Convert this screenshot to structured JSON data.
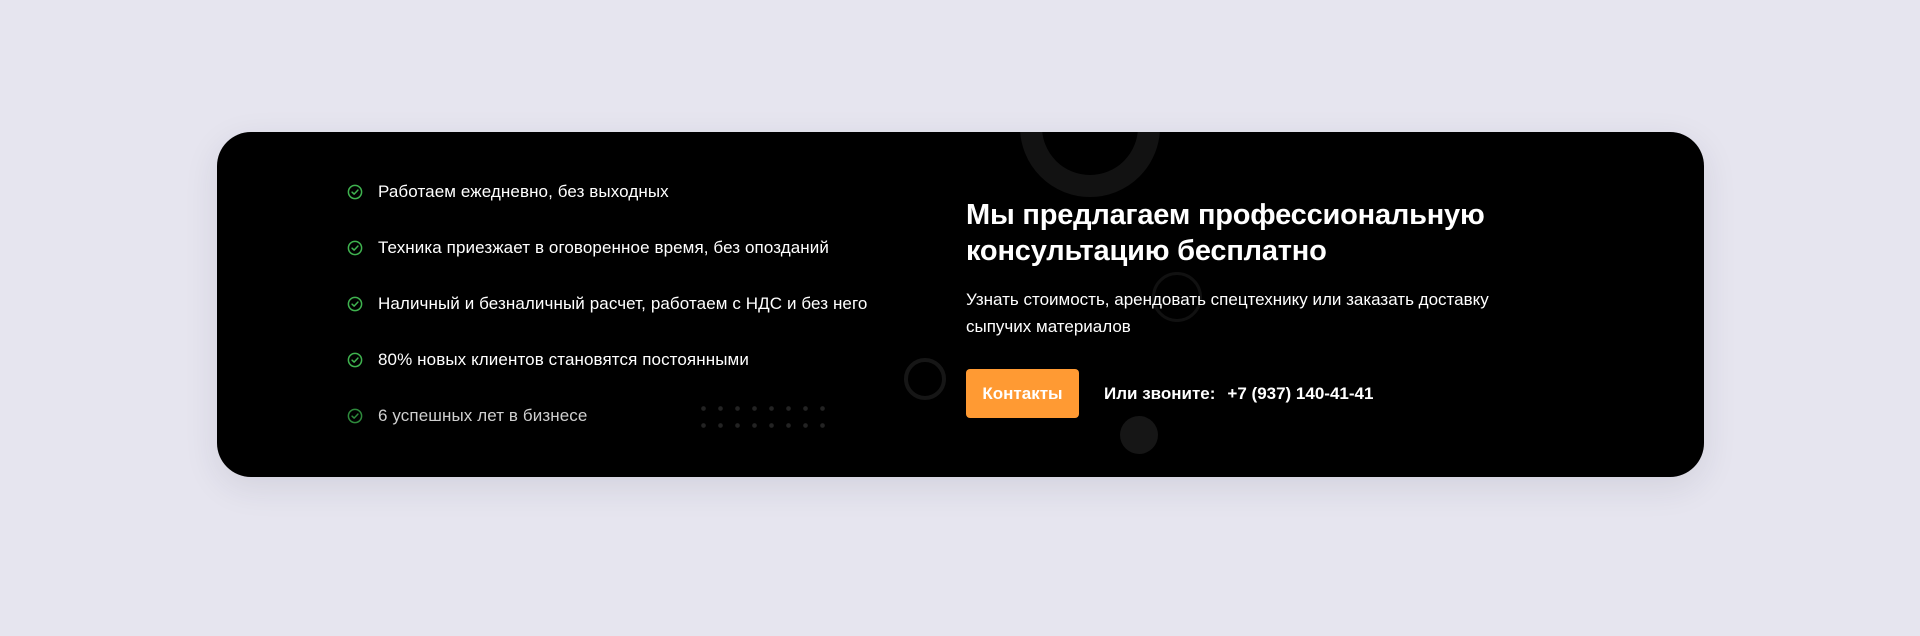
{
  "colors": {
    "page_background": "#e6e5ef",
    "card_background": "#000000",
    "accent": "#ff9a33",
    "check": "#3fb34f",
    "text": "#ffffff"
  },
  "features": [
    {
      "icon": "check-circle-icon",
      "text": "Работаем ежедневно, без выходных"
    },
    {
      "icon": "check-circle-icon",
      "text": "Техника приезжает в оговоренное время, без опозданий"
    },
    {
      "icon": "check-circle-icon",
      "text": "Наличный и безналичный расчет, работаем с НДС и без него"
    },
    {
      "icon": "check-circle-icon",
      "text": "80% новых клиентов становятся постоянными"
    },
    {
      "icon": "check-circle-icon",
      "text": "6 успешных лет в бизнесе"
    }
  ],
  "cta": {
    "title": "Мы предлагаем профессиональную консультацию бесплатно",
    "subtitle": "Узнать стоимость, арендовать спецтехнику или заказать доставку сыпучих материалов",
    "button_label": "Контакты",
    "call_label": "Или звоните:",
    "phone": "+7 (937) 140-41-41"
  }
}
